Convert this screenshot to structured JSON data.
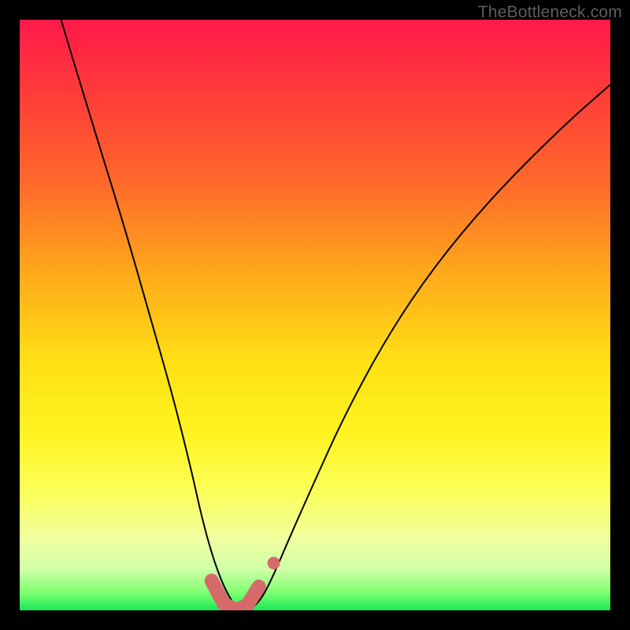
{
  "watermark": "TheBottleneck.com",
  "chart_data": {
    "type": "line",
    "title": "",
    "xlabel": "",
    "ylabel": "",
    "xlim": [
      0,
      100
    ],
    "ylim": [
      0,
      100
    ],
    "background": "rainbow-gradient vertical (red top to green bottom)",
    "series": [
      {
        "name": "bottleneck-curve",
        "description": "V-shaped curve; steep descent on left, shallower rise on right; minimum near x≈37 at y≈0",
        "x": [
          7,
          10,
          14,
          18,
          22,
          26,
          29,
          31,
          33,
          35,
          37,
          39,
          41,
          43,
          46,
          50,
          55,
          62,
          70,
          80,
          92,
          100
        ],
        "y": [
          100,
          90,
          77,
          64,
          50,
          36,
          24,
          15,
          8,
          3,
          0,
          0,
          2,
          6,
          13,
          22,
          33,
          46,
          58,
          70,
          82,
          89
        ]
      }
    ],
    "highlight": {
      "name": "optimal-range",
      "description": "thick salmon segment marking the flat bottom of the curve",
      "x": [
        32.5,
        34.5,
        36.5,
        38.5,
        40.5
      ],
      "y": [
        5,
        1.2,
        0,
        0.8,
        4
      ]
    },
    "marker": {
      "name": "value-dot",
      "x": 43,
      "y": 8
    }
  }
}
